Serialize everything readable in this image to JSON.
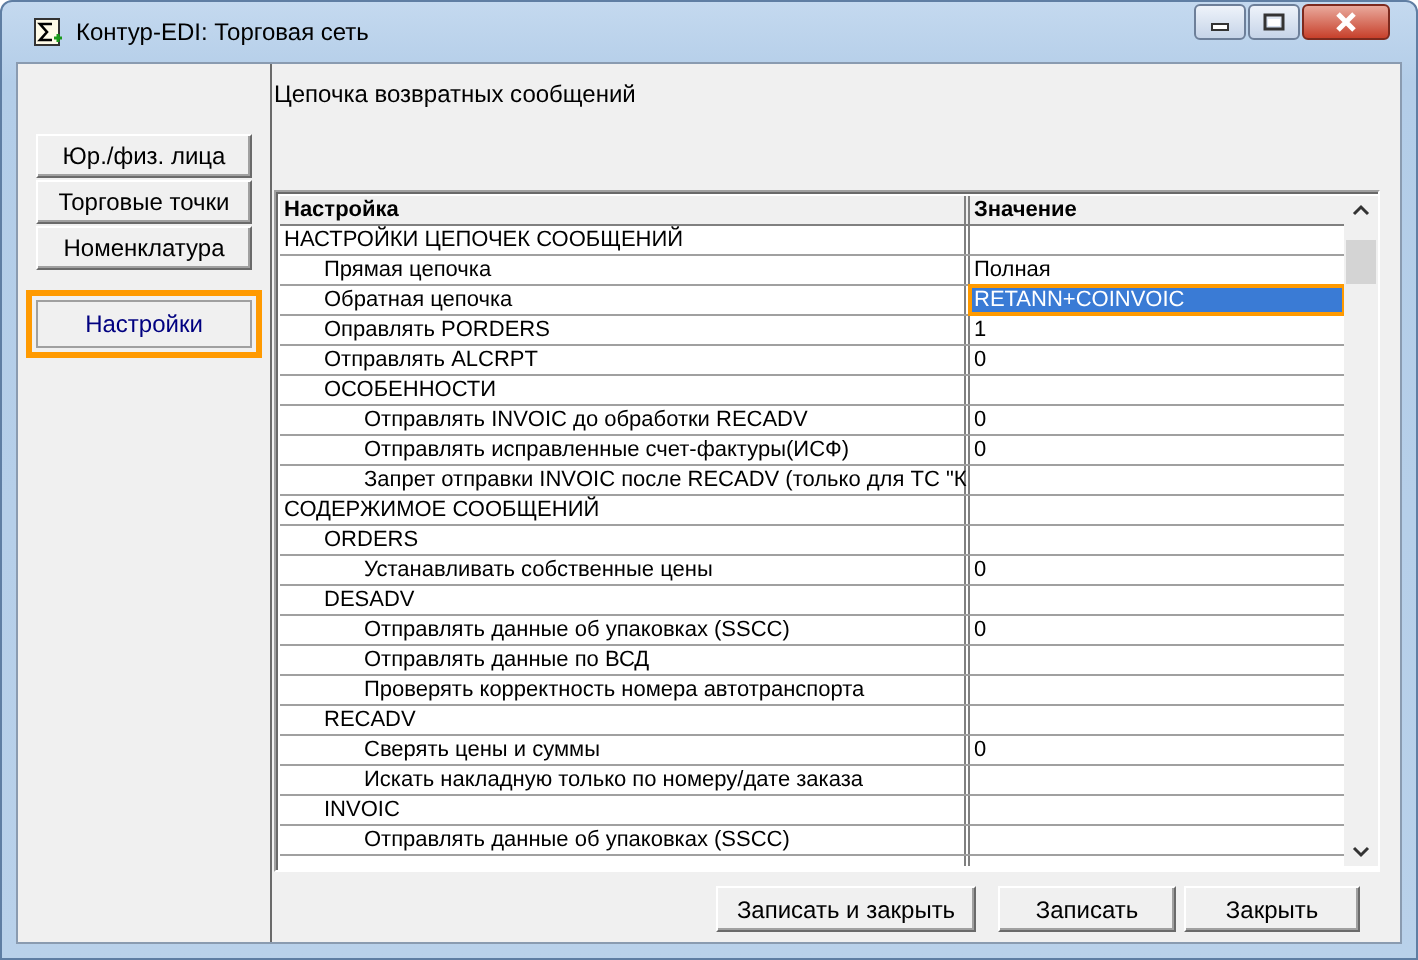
{
  "window": {
    "title": "Контур-EDI: Торговая сеть"
  },
  "caption": "Цепочка возвратных сообщений",
  "nav": [
    {
      "label": "Юр./физ. лица",
      "selected": false
    },
    {
      "label": "Торговые точки",
      "selected": false
    },
    {
      "label": "Номенклатура",
      "selected": false
    },
    {
      "label": "Настройки",
      "selected": true
    }
  ],
  "table": {
    "columns": [
      "Настройка",
      "Значение"
    ],
    "rows": [
      {
        "label": "НАСТРОЙКИ ЦЕПОЧЕК СООБЩЕНИЙ",
        "selected": false,
        "children": [
          {
            "label": "Прямая цепочка",
            "value": "Полная",
            "selected": false
          },
          {
            "label": "Обратная цепочка",
            "value": "RETANN+COINVOIC",
            "selected": true
          },
          {
            "label": "Оправлять PORDERS",
            "value": "1",
            "selected": false
          },
          {
            "label": "Отправлять ALCRPT",
            "value": "0",
            "selected": false
          },
          {
            "label": "ОСОБЕННОСТИ",
            "selected": false,
            "children": [
              {
                "label": "Отправлять INVOIC до обработки RECADV",
                "value": "0",
                "selected": false
              },
              {
                "label": "Отправлять исправленные счет-фактуры(ИСФ)",
                "value": "0",
                "selected": false
              },
              {
                "label": "Запрет отправки INVOIC после RECADV (только для ТС \"К",
                "selected": false
              }
            ]
          }
        ]
      },
      {
        "label": "СОДЕРЖИМОЕ СООБЩЕНИЙ",
        "selected": false,
        "children": [
          {
            "label": "ORDERS",
            "selected": false,
            "children": [
              {
                "label": "Устанавливать собственные цены",
                "value": "0",
                "selected": false
              }
            ]
          },
          {
            "label": "DESADV",
            "selected": false,
            "children": [
              {
                "label": "Отправлять данные об упаковках (SSCC)",
                "value": "0",
                "selected": false
              },
              {
                "label": "Отправлять данные по ВСД",
                "selected": false
              },
              {
                "label": "Проверять корректность номера автотранспорта",
                "selected": false
              }
            ]
          },
          {
            "label": "RECADV",
            "selected": false,
            "children": [
              {
                "label": "Сверять цены и суммы",
                "value": "0",
                "selected": false
              },
              {
                "label": "Искать накладную только по номеру/дате заказа",
                "selected": false
              }
            ]
          },
          {
            "label": "INVOIC",
            "selected": false,
            "children": [
              {
                "label": "Отправлять данные об упаковках (SSCC)",
                "selected": false
              }
            ]
          }
        ]
      }
    ]
  },
  "buttons": [
    "Записать и закрыть",
    "Записать",
    "Закрыть"
  ]
}
